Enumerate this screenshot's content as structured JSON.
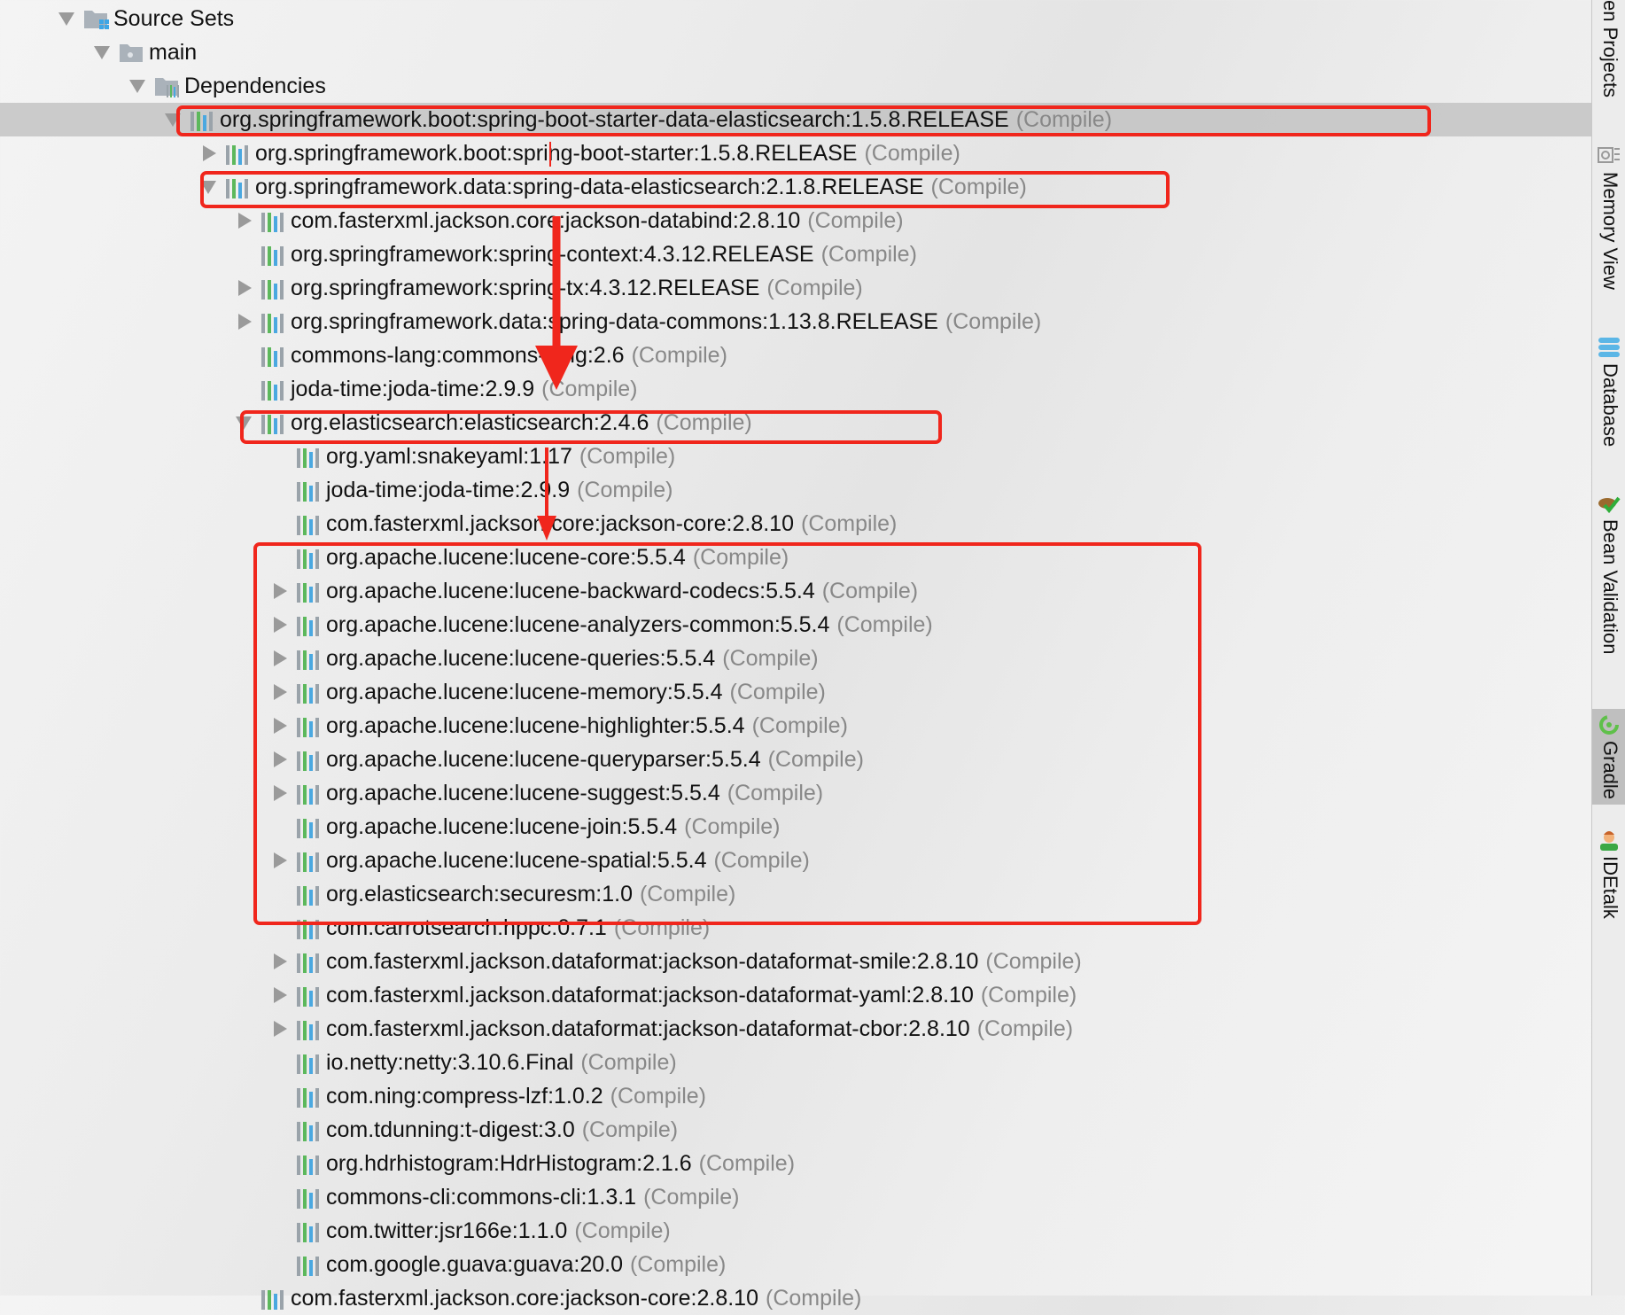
{
  "tree": {
    "scope_label": "(Compile)",
    "rows": [
      {
        "level": 0,
        "arrow": "down",
        "icon": "source-sets-folder-icon",
        "text": "Source Sets",
        "scope": false
      },
      {
        "level": 1,
        "arrow": "down",
        "icon": "module-folder-icon",
        "text": "main",
        "scope": false
      },
      {
        "level": 2,
        "arrow": "down",
        "icon": "dependencies-folder-icon",
        "text": "Dependencies",
        "scope": false
      },
      {
        "level": 3,
        "arrow": "down",
        "icon": "library-icon",
        "text": "org.springframework.boot:spring-boot-starter-data-elasticsearch:1.5.8.RELEASE",
        "scope": true,
        "selected": true
      },
      {
        "level": 4,
        "arrow": "right",
        "icon": "library-icon",
        "text": "org.springframework.boot:spring-boot-starter:1.5.8.RELEASE",
        "scope": true
      },
      {
        "level": 4,
        "arrow": "down",
        "icon": "library-icon",
        "text": "org.springframework.data:spring-data-elasticsearch:2.1.8.RELEASE",
        "scope": true
      },
      {
        "level": 5,
        "arrow": "right",
        "icon": "library-icon",
        "text": "com.fasterxml.jackson.core:jackson-databind:2.8.10",
        "scope": true
      },
      {
        "level": 5,
        "arrow": "none",
        "icon": "library-icon",
        "text": "org.springframework:spring-context:4.3.12.RELEASE",
        "scope": true
      },
      {
        "level": 5,
        "arrow": "right",
        "icon": "library-icon",
        "text": "org.springframework:spring-tx:4.3.12.RELEASE",
        "scope": true
      },
      {
        "level": 5,
        "arrow": "right",
        "icon": "library-icon",
        "text": "org.springframework.data:spring-data-commons:1.13.8.RELEASE",
        "scope": true
      },
      {
        "level": 5,
        "arrow": "none",
        "icon": "library-icon",
        "text": "commons-lang:commons-lang:2.6",
        "scope": true
      },
      {
        "level": 5,
        "arrow": "none",
        "icon": "library-icon",
        "text": "joda-time:joda-time:2.9.9",
        "scope": true
      },
      {
        "level": 5,
        "arrow": "down",
        "icon": "library-icon",
        "text": "org.elasticsearch:elasticsearch:2.4.6",
        "scope": true
      },
      {
        "level": 6,
        "arrow": "none",
        "icon": "library-icon",
        "text": "org.yaml:snakeyaml:1.17",
        "scope": true
      },
      {
        "level": 6,
        "arrow": "none",
        "icon": "library-icon",
        "text": "joda-time:joda-time:2.9.9",
        "scope": true
      },
      {
        "level": 6,
        "arrow": "none",
        "icon": "library-icon",
        "text": "com.fasterxml.jackson.core:jackson-core:2.8.10",
        "scope": true
      },
      {
        "level": 6,
        "arrow": "none",
        "icon": "library-icon",
        "text": "org.apache.lucene:lucene-core:5.5.4",
        "scope": true
      },
      {
        "level": 6,
        "arrow": "right",
        "icon": "library-icon",
        "text": "org.apache.lucene:lucene-backward-codecs:5.5.4",
        "scope": true
      },
      {
        "level": 6,
        "arrow": "right",
        "icon": "library-icon",
        "text": "org.apache.lucene:lucene-analyzers-common:5.5.4",
        "scope": true
      },
      {
        "level": 6,
        "arrow": "right",
        "icon": "library-icon",
        "text": "org.apache.lucene:lucene-queries:5.5.4",
        "scope": true
      },
      {
        "level": 6,
        "arrow": "right",
        "icon": "library-icon",
        "text": "org.apache.lucene:lucene-memory:5.5.4",
        "scope": true
      },
      {
        "level": 6,
        "arrow": "right",
        "icon": "library-icon",
        "text": "org.apache.lucene:lucene-highlighter:5.5.4",
        "scope": true
      },
      {
        "level": 6,
        "arrow": "right",
        "icon": "library-icon",
        "text": "org.apache.lucene:lucene-queryparser:5.5.4",
        "scope": true
      },
      {
        "level": 6,
        "arrow": "right",
        "icon": "library-icon",
        "text": "org.apache.lucene:lucene-suggest:5.5.4",
        "scope": true
      },
      {
        "level": 6,
        "arrow": "none",
        "icon": "library-icon",
        "text": "org.apache.lucene:lucene-join:5.5.4",
        "scope": true
      },
      {
        "level": 6,
        "arrow": "right",
        "icon": "library-icon",
        "text": "org.apache.lucene:lucene-spatial:5.5.4",
        "scope": true
      },
      {
        "level": 6,
        "arrow": "none",
        "icon": "library-icon",
        "text": "org.elasticsearch:securesm:1.0",
        "scope": true
      },
      {
        "level": 6,
        "arrow": "none",
        "icon": "library-icon",
        "text": "com.carrotsearch:hppc:0.7.1",
        "scope": true
      },
      {
        "level": 6,
        "arrow": "right",
        "icon": "library-icon",
        "text": "com.fasterxml.jackson.dataformat:jackson-dataformat-smile:2.8.10",
        "scope": true
      },
      {
        "level": 6,
        "arrow": "right",
        "icon": "library-icon",
        "text": "com.fasterxml.jackson.dataformat:jackson-dataformat-yaml:2.8.10",
        "scope": true
      },
      {
        "level": 6,
        "arrow": "right",
        "icon": "library-icon",
        "text": "com.fasterxml.jackson.dataformat:jackson-dataformat-cbor:2.8.10",
        "scope": true
      },
      {
        "level": 6,
        "arrow": "none",
        "icon": "library-icon",
        "text": "io.netty:netty:3.10.6.Final",
        "scope": true
      },
      {
        "level": 6,
        "arrow": "none",
        "icon": "library-icon",
        "text": "com.ning:compress-lzf:1.0.2",
        "scope": true
      },
      {
        "level": 6,
        "arrow": "none",
        "icon": "library-icon",
        "text": "com.tdunning:t-digest:3.0",
        "scope": true
      },
      {
        "level": 6,
        "arrow": "none",
        "icon": "library-icon",
        "text": "org.hdrhistogram:HdrHistogram:2.1.6",
        "scope": true
      },
      {
        "level": 6,
        "arrow": "none",
        "icon": "library-icon",
        "text": "commons-cli:commons-cli:1.3.1",
        "scope": true
      },
      {
        "level": 6,
        "arrow": "none",
        "icon": "library-icon",
        "text": "com.twitter:jsr166e:1.1.0",
        "scope": true
      },
      {
        "level": 6,
        "arrow": "none",
        "icon": "library-icon",
        "text": "com.google.guava:guava:20.0",
        "scope": true
      },
      {
        "level": 5,
        "arrow": "none",
        "icon": "library-icon",
        "text": "com.fasterxml.jackson.core:jackson-core:2.8.10",
        "scope": true
      }
    ]
  },
  "sidebar": {
    "items": [
      {
        "label": "en Projects",
        "icon": "maven-icon",
        "active": false
      },
      {
        "label": "Memory View",
        "icon": "memory-view-icon",
        "active": false
      },
      {
        "label": "Database",
        "icon": "database-icon",
        "active": false
      },
      {
        "label": "Bean Validation",
        "icon": "bean-validation-icon",
        "active": false
      },
      {
        "label": "Gradle",
        "icon": "gradle-icon",
        "active": true
      },
      {
        "label": "IDEtalk",
        "icon": "idetalk-icon",
        "active": false
      }
    ]
  },
  "annotations": {
    "color": "#f0261c"
  }
}
